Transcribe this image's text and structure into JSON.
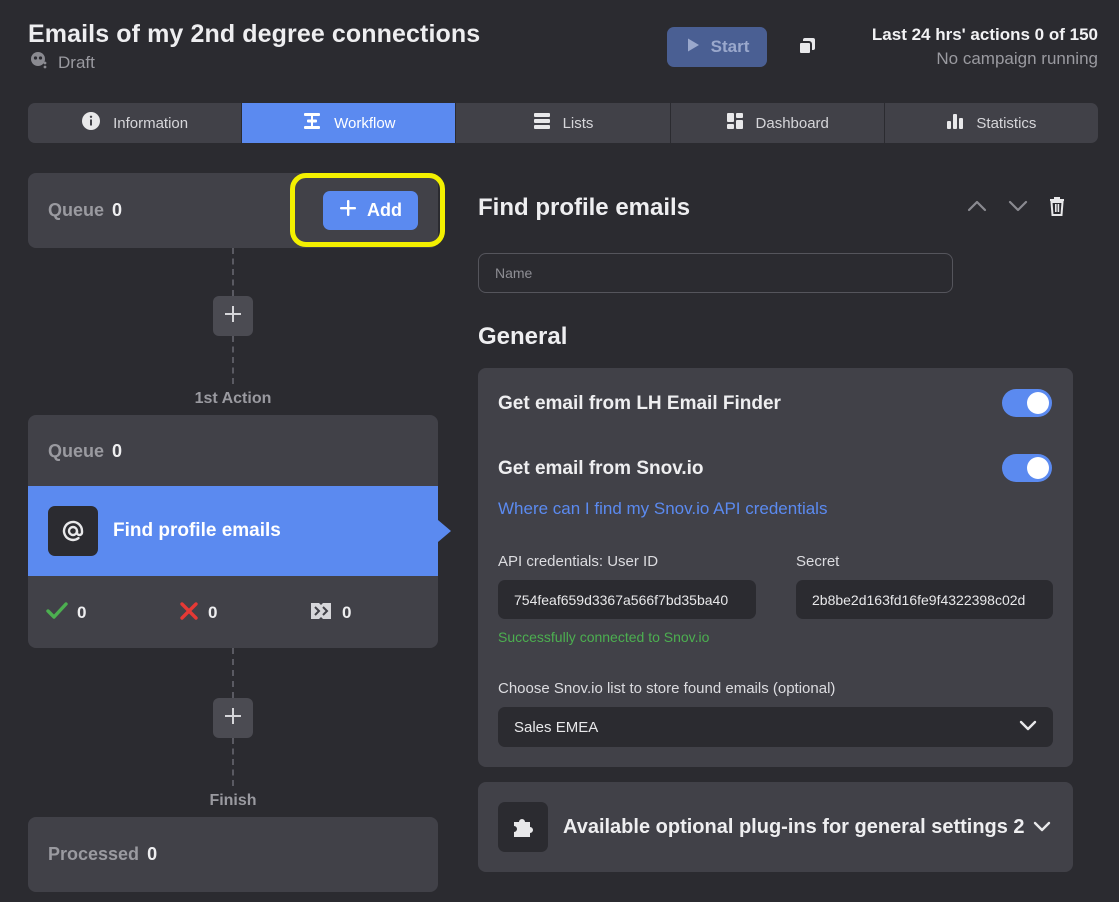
{
  "header": {
    "title": "Emails of my 2nd degree connections",
    "status": "Draft",
    "start_label": "Start",
    "limits_line1": "Last 24 hrs' actions 0 of 150",
    "limits_line2": "No campaign running"
  },
  "tabs": [
    {
      "label": "Information",
      "icon": "info-icon",
      "active": false
    },
    {
      "label": "Workflow",
      "icon": "workflow-icon",
      "active": true
    },
    {
      "label": "Lists",
      "icon": "list-icon",
      "active": false
    },
    {
      "label": "Dashboard",
      "icon": "dashboard-icon",
      "active": false
    },
    {
      "label": "Statistics",
      "icon": "bar-chart-icon",
      "active": false
    }
  ],
  "workflow": {
    "queue_label": "Queue",
    "queue_top_count": "0",
    "add_label": "Add",
    "first_action_label": "1st Action",
    "action_queue_count": "0",
    "action_name": "Find profile emails",
    "success_count": "0",
    "failed_count": "0",
    "skipped_count": "0",
    "finish_label": "Finish",
    "processed_label": "Processed",
    "processed_count": "0"
  },
  "detail": {
    "title": "Find profile emails",
    "name_placeholder": "Name",
    "general_heading": "General",
    "option1_label": "Get email from LH Email Finder",
    "option1_enabled": true,
    "option2_label": "Get email from Snov.io",
    "option2_enabled": true,
    "help_link": "Where can I find my Snov.io API credentials",
    "user_id_label": "API credentials: User ID",
    "user_id_value": "754feaf659d3367a566f7bd35ba40",
    "secret_label": "Secret",
    "secret_value": "2b8be2d163fd16fe9f4322398c02d",
    "connection_status": "Successfully connected to Snov.io",
    "list_label": "Choose Snov.io list to store found emails (optional)",
    "list_selected": "Sales EMEA",
    "plugins_label": "Available optional plug-ins for general settings 2"
  },
  "colors": {
    "background": "#2b2b30",
    "card": "#414148",
    "accent": "#5b8af0",
    "success": "#4caf50",
    "danger": "#e53935",
    "highlight": "#f3f000"
  }
}
